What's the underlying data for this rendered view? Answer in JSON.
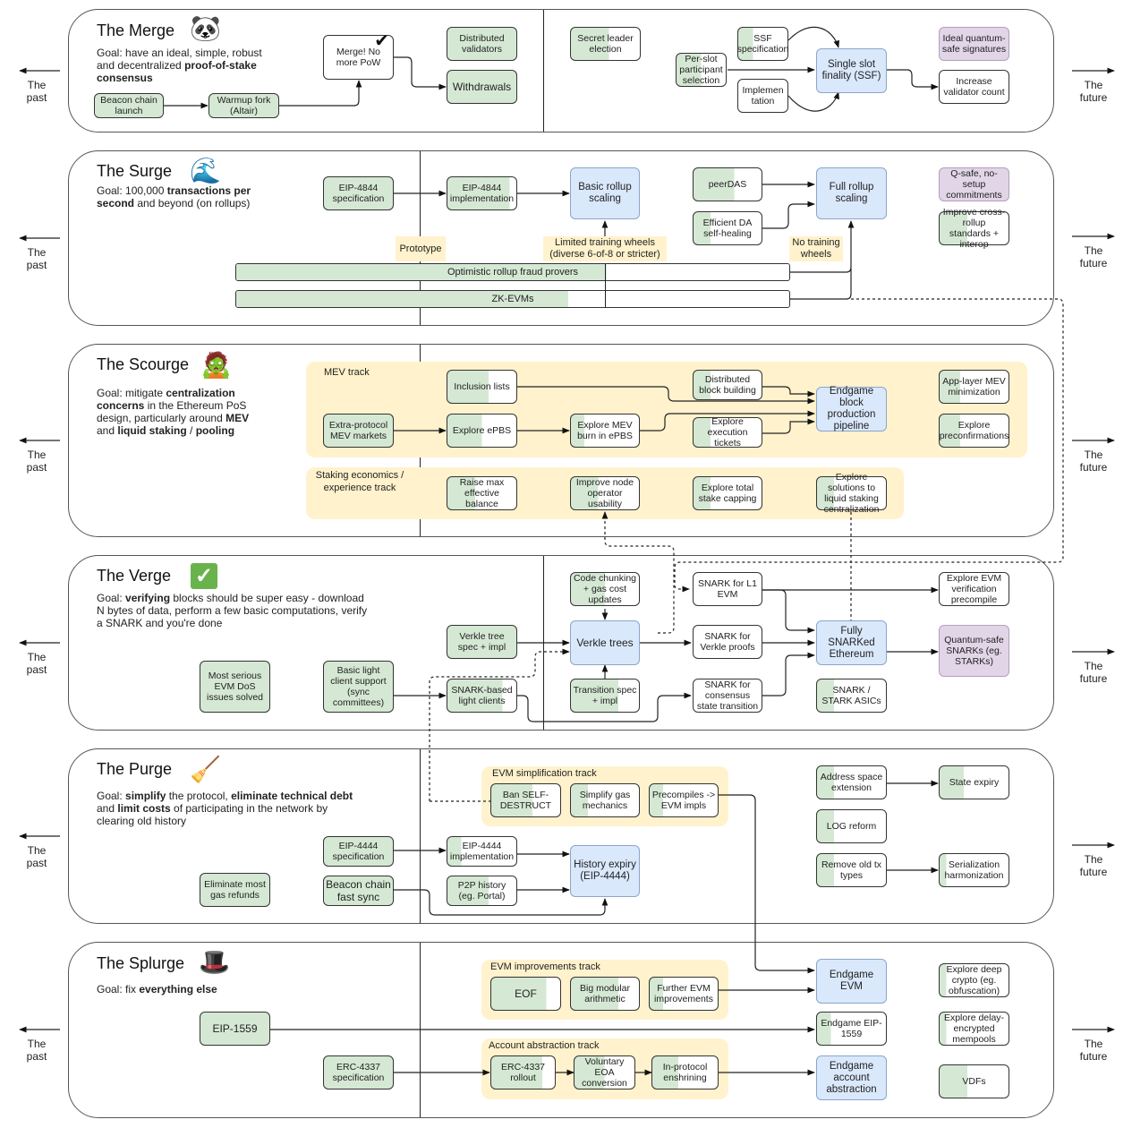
{
  "past_label": "The past",
  "future_label": "The future",
  "rows": [
    {
      "id": "merge",
      "title": "The Merge",
      "icon": "panda-icon",
      "icon_glyph": "🐼",
      "goal_html": "Goal: have an ideal, simple, robust and decentralized <b>proof-of-stake consensus</b>",
      "boxes": [
        {
          "id": "beacon-chain-launch",
          "label": "Beacon chain launch",
          "state": "done"
        },
        {
          "id": "warmup-fork",
          "label": "Warmup fork (Altair)",
          "state": "done"
        },
        {
          "id": "merge-no-pow",
          "label": "Merge! No more PoW",
          "state": "goal",
          "checkmark": "✔"
        },
        {
          "id": "distributed-validators",
          "label": "Distributed validators",
          "state": "done"
        },
        {
          "id": "withdrawals",
          "label": "Withdrawals",
          "state": "done"
        },
        {
          "id": "secret-leader-election",
          "label": "Secret leader election",
          "state": "partial",
          "progress": 0.55
        },
        {
          "id": "ssf-specification",
          "label": "SSF specification",
          "state": "partial",
          "progress": 0.3
        },
        {
          "id": "per-slot-participant-selection",
          "label": "Per-slot participant selection",
          "state": "partial",
          "progress": 0.5
        },
        {
          "id": "implementation",
          "label": "Implemen tation",
          "state": "todo"
        },
        {
          "id": "single-slot-finality",
          "label": "Single slot finality (SSF)",
          "state": "goal"
        },
        {
          "id": "ideal-quantum-safe-signatures",
          "label": "Ideal quantum-safe signatures",
          "state": "quantum"
        },
        {
          "id": "increase-validator-count",
          "label": "Increase validator count",
          "state": "todo"
        }
      ]
    },
    {
      "id": "surge",
      "title": "The Surge",
      "icon": "wave-icon",
      "icon_glyph": "🌊",
      "goal_html": "Goal: 100,000 <b>transactions per second</b> and beyond (on rollups)",
      "boxes": [
        {
          "id": "eip-4844-specification",
          "label": "EIP-4844 specification",
          "state": "done"
        },
        {
          "id": "eip-4844-implementation",
          "label": "EIP-4844 implementation",
          "state": "partial",
          "progress": 0.9
        },
        {
          "id": "basic-rollup-scaling",
          "label": "Basic rollup scaling",
          "state": "goal"
        },
        {
          "id": "peerdas",
          "label": "peerDAS",
          "state": "partial",
          "progress": 0.6
        },
        {
          "id": "efficient-da-self-healing",
          "label": "Efficient DA self-healing",
          "state": "partial",
          "progress": 0.25
        },
        {
          "id": "full-rollup-scaling",
          "label": "Full rollup scaling",
          "state": "goal"
        },
        {
          "id": "q-safe-commitments",
          "label": "Q-safe, no-setup commitments",
          "state": "quantum"
        },
        {
          "id": "cross-rollup-standards",
          "label": "Improve cross-rollup standards + interop",
          "state": "partial",
          "progress": 0.4
        }
      ],
      "notes": [
        {
          "id": "prototype",
          "label": "Prototype"
        },
        {
          "id": "limited-training-wheels",
          "label": "Limited training wheels (diverse 6-of-8 or stricter)"
        },
        {
          "id": "no-training-wheels",
          "label": "No training wheels"
        }
      ],
      "bars": [
        {
          "id": "optimistic-rollup-fraud-provers",
          "label": "Optimistic rollup fraud provers",
          "progress": 0.67
        },
        {
          "id": "zk-evms",
          "label": "ZK-EVMs",
          "progress": 0.6
        }
      ]
    },
    {
      "id": "scourge",
      "title": "The Scourge",
      "icon": "zombie-icon",
      "icon_glyph": "🧟",
      "goal_html": "Goal: mitigate <b>centralization concerns</b> in the Ethereum PoS design, particularly around <b>MEV</b> and <b>liquid staking</b> / <b>pooling</b>",
      "tracks": [
        {
          "id": "mev-track",
          "label": "MEV track"
        },
        {
          "id": "staking-track",
          "label": "Staking economics / experience track"
        }
      ],
      "boxes": [
        {
          "id": "inclusion-lists",
          "label": "Inclusion lists",
          "state": "partial",
          "progress": 0.6
        },
        {
          "id": "extra-protocol-mev-markets",
          "label": "Extra-protocol MEV markets",
          "state": "done"
        },
        {
          "id": "explore-epbs",
          "label": "Explore ePBS",
          "state": "partial",
          "progress": 0.5
        },
        {
          "id": "explore-mev-burn",
          "label": "Explore MEV burn in ePBS",
          "state": "partial",
          "progress": 0.2
        },
        {
          "id": "distributed-block-building",
          "label": "Distributed block building",
          "state": "partial",
          "progress": 0.25
        },
        {
          "id": "explore-execution-tickets",
          "label": "Explore execution tickets",
          "state": "partial",
          "progress": 0.25
        },
        {
          "id": "endgame-block-production",
          "label": "Endgame block production pipeline",
          "state": "goal"
        },
        {
          "id": "app-layer-mev-minimization",
          "label": "App-layer MEV minimization",
          "state": "partial",
          "progress": 0.3
        },
        {
          "id": "explore-preconfirmations",
          "label": "Explore preconfirmations",
          "state": "partial",
          "progress": 0.3
        },
        {
          "id": "raise-max-effective-balance",
          "label": "Raise max effective balance",
          "state": "partial",
          "progress": 0.4
        },
        {
          "id": "improve-node-operator-usability",
          "label": "Improve node operator usability",
          "state": "partial",
          "progress": 0.4
        },
        {
          "id": "explore-total-stake-capping",
          "label": "Explore total stake capping",
          "state": "partial",
          "progress": 0.25
        },
        {
          "id": "explore-liquid-staking-solutions",
          "label": "Explore solutions to liquid staking centralization",
          "state": "partial",
          "progress": 0.25
        }
      ]
    },
    {
      "id": "verge",
      "title": "The Verge",
      "icon": "check-mark-icon",
      "icon_glyph": "✓",
      "goal_html": "Goal: <b>verifying</b> blocks should be super easy - download N bytes of data, perform a few basic computations, verify a SNARK and you're done",
      "boxes": [
        {
          "id": "most-serious-evm-dos",
          "label": "Most serious EVM DoS issues solved",
          "state": "done"
        },
        {
          "id": "basic-light-client-support",
          "label": "Basic light client support (sync committees)",
          "state": "done"
        },
        {
          "id": "verkle-tree-spec",
          "label": "Verkle tree spec + impl",
          "state": "done"
        },
        {
          "id": "snark-based-light-clients",
          "label": "SNARK-based light clients",
          "state": "partial",
          "progress": 0.8
        },
        {
          "id": "code-chunking",
          "label": "Code chunking + gas cost updates",
          "state": "partial",
          "progress": 0.5
        },
        {
          "id": "verkle-trees",
          "label": "Verkle trees",
          "state": "goal"
        },
        {
          "id": "transition-spec",
          "label": "Transition spec + impl",
          "state": "partial",
          "progress": 0.7
        },
        {
          "id": "snark-for-l1-evm",
          "label": "SNARK for L1 EVM",
          "state": "todo"
        },
        {
          "id": "snark-for-verkle-proofs",
          "label": "SNARK for Verkle proofs",
          "state": "todo"
        },
        {
          "id": "snark-for-consensus-state",
          "label": "SNARK for consensus state transition",
          "state": "todo"
        },
        {
          "id": "fully-snarked-ethereum",
          "label": "Fully SNARKed Ethereum",
          "state": "goal"
        },
        {
          "id": "snark-stark-asics",
          "label": "SNARK / STARK ASICs",
          "state": "partial",
          "progress": 0.25
        },
        {
          "id": "explore-evm-verification-precompile",
          "label": "Explore EVM verification precompile",
          "state": "todo"
        },
        {
          "id": "quantum-safe-snarks",
          "label": "Quantum-safe SNARKs (eg. STARKs)",
          "state": "quantum"
        }
      ]
    },
    {
      "id": "purge",
      "title": "The Purge",
      "icon": "broom-icon",
      "icon_glyph": "🧹",
      "goal_html": "Goal: <b>simplify</b> the protocol, <b>eliminate technical debt</b> and <b>limit costs</b> of participating in the network by clearing old history",
      "tracks": [
        {
          "id": "evm-simplification-track",
          "label": "EVM simplification track"
        }
      ],
      "boxes": [
        {
          "id": "eliminate-gas-refunds",
          "label": "Eliminate most gas refunds",
          "state": "done"
        },
        {
          "id": "eip-4444-specification",
          "label": "EIP-4444 specification",
          "state": "done"
        },
        {
          "id": "beacon-chain-fast-sync",
          "label": "Beacon chain fast sync",
          "state": "done"
        },
        {
          "id": "eip-4444-implementation",
          "label": "EIP-4444 implementation",
          "state": "partial",
          "progress": 0.2
        },
        {
          "id": "p2p-history",
          "label": "P2P history (eg. Portal)",
          "state": "partial",
          "progress": 0.6
        },
        {
          "id": "history-expiry",
          "label": "History expiry (EIP-4444)",
          "state": "goal"
        },
        {
          "id": "ban-selfdestruct",
          "label": "Ban SELF-DESTRUCT",
          "state": "partial",
          "progress": 0.6
        },
        {
          "id": "simplify-gas-mechanics",
          "label": "Simplify gas mechanics",
          "state": "partial",
          "progress": 0.25
        },
        {
          "id": "precompiles-to-evm",
          "label": "Precompiles -> EVM impls",
          "state": "partial",
          "progress": 0.2
        },
        {
          "id": "address-space-extension",
          "label": "Address space extension",
          "state": "partial",
          "progress": 0.25
        },
        {
          "id": "state-expiry",
          "label": "State expiry",
          "state": "partial",
          "progress": 0.35
        },
        {
          "id": "log-reform",
          "label": "LOG reform",
          "state": "partial",
          "progress": 0.25
        },
        {
          "id": "remove-old-tx-types",
          "label": "Remove old tx types",
          "state": "partial",
          "progress": 0.25
        },
        {
          "id": "serialization-harmonization",
          "label": "Serialization harmonization",
          "state": "partial",
          "progress": 0.1
        }
      ]
    },
    {
      "id": "splurge",
      "title": "The Splurge",
      "icon": "top-hat-icon",
      "icon_glyph": "🎩",
      "goal_html": "Goal: fix <b>everything else</b>",
      "tracks": [
        {
          "id": "evm-improvements-track",
          "label": "EVM improvements track"
        },
        {
          "id": "account-abstraction-track",
          "label": "Account abstraction track"
        }
      ],
      "boxes": [
        {
          "id": "eip-1559",
          "label": "EIP-1559",
          "state": "done"
        },
        {
          "id": "erc-4337-specification",
          "label": "ERC-4337 specification",
          "state": "done"
        },
        {
          "id": "eof",
          "label": "EOF",
          "state": "partial",
          "progress": 0.8
        },
        {
          "id": "big-modular-arithmetic",
          "label": "Big modular arithmetic",
          "state": "partial",
          "progress": 0.7
        },
        {
          "id": "further-evm-improvements",
          "label": "Further EVM improvements",
          "state": "partial",
          "progress": 0.2
        },
        {
          "id": "erc-4337-rollout",
          "label": "ERC-4337 rollout",
          "state": "partial",
          "progress": 0.8
        },
        {
          "id": "voluntary-eoa-conversion",
          "label": "Voluntary EOA conversion",
          "state": "partial",
          "progress": 0.5
        },
        {
          "id": "in-protocol-enshrining",
          "label": "In-protocol enshrining",
          "state": "partial",
          "progress": 0.4
        },
        {
          "id": "endgame-evm",
          "label": "Endgame EVM",
          "state": "goal"
        },
        {
          "id": "endgame-eip-1559",
          "label": "Endgame EIP-1559",
          "state": "partial",
          "progress": 0.2
        },
        {
          "id": "endgame-account-abstraction",
          "label": "Endgame account abstraction",
          "state": "goal"
        },
        {
          "id": "explore-deep-crypto",
          "label": "Explore deep crypto (eg. obfuscation)",
          "state": "partial",
          "progress": 0.1
        },
        {
          "id": "explore-delay-encrypted-mempools",
          "label": "Explore delay-encrypted mempools",
          "state": "partial",
          "progress": 0.1
        },
        {
          "id": "vdfs",
          "label": "VDFs",
          "state": "partial",
          "progress": 0.4
        }
      ]
    }
  ],
  "colors": {
    "done": "#d5e8d4",
    "goal": "#dae8fc",
    "quantum": "#e1d5e7",
    "track": "#fff2cc"
  }
}
